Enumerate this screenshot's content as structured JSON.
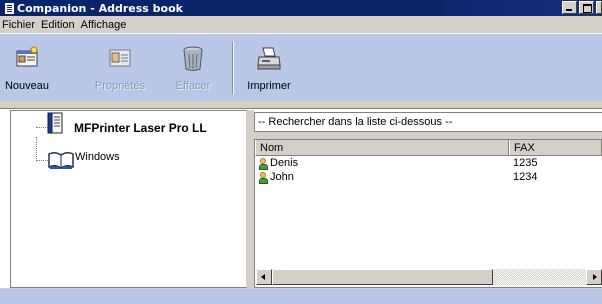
{
  "window": {
    "title": "Companion - Address book"
  },
  "menu": {
    "items": [
      "Fichier",
      "Edition",
      "Affichage"
    ]
  },
  "toolbar": {
    "buttons": [
      {
        "label": "Nouveau",
        "icon": "new-contact-icon",
        "enabled": true
      },
      {
        "label": "Propriétés",
        "icon": "properties-card-icon",
        "enabled": false
      },
      {
        "label": "Effacer",
        "icon": "trash-icon",
        "enabled": false
      },
      {
        "label": "Imprimer",
        "icon": "printer-icon",
        "enabled": true
      }
    ]
  },
  "tree": {
    "items": [
      {
        "label": "MFPrinter Laser Pro LL",
        "icon": "address-book-icon"
      },
      {
        "label": "Windows",
        "icon": "open-book-icon"
      }
    ]
  },
  "search": {
    "placeholder": "-- Rechercher dans la liste ci-dessous --"
  },
  "list": {
    "columns": [
      "Nom",
      "FAX"
    ],
    "rows": [
      {
        "name": "Denis",
        "fax": "1235"
      },
      {
        "name": "John",
        "fax": "1234"
      }
    ]
  },
  "colors": {
    "toolbar_bg": "#b8c8e6",
    "titlebar": "#0a246a",
    "chrome": "#d4d0c8"
  }
}
